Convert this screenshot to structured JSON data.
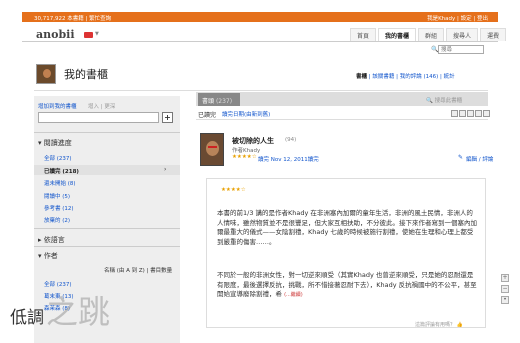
{
  "topbar": {
    "stats": "30,717,922 本書籍 | 繁忙查詢",
    "links": "我是Khady | 設定 | 登出"
  },
  "header": {
    "logo": "anobii",
    "search_placeholder": "搜尋"
  },
  "nav": {
    "tabs": [
      "首頁",
      "我的書櫃",
      "群組",
      "搜尋人",
      "運費"
    ]
  },
  "shelf": {
    "title": "我的書櫃",
    "links": {
      "current": "書櫃",
      "friends": "該關書籍",
      "reviews": "我的評論 (146)",
      "stats": "統計"
    }
  },
  "sidebar": {
    "add_label": "增加到我的書櫃",
    "add_hint": "增入 | 更深",
    "reading_status": "閱讀進度",
    "status_items": [
      {
        "label": "全部 (237)",
        "selected": false
      },
      {
        "label": "已讀完 (218)",
        "selected": true
      },
      {
        "label": "還未開始 (8)",
        "selected": false
      },
      {
        "label": "閱讀中 (5)",
        "selected": false
      },
      {
        "label": "參考書 (12)",
        "selected": false
      },
      {
        "label": "放棄的 (2)",
        "selected": false
      }
    ],
    "language": "依語言",
    "authors": "作者",
    "authors_sort": "名稱 (由 A 到 Z) | 書目數量",
    "author_items": [
      "全部 (237)",
      "葛末東 (13)",
      "森茉森 (8)"
    ]
  },
  "main": {
    "tab_label": "書頭",
    "tab_count": "(237)",
    "search_placeholder": "搜尋此書櫃",
    "filter_read": "已讀完",
    "filter_sort": "讀完日期(由新到舊)"
  },
  "book": {
    "title": "被切除的人生",
    "count": "(94)",
    "author": "作者Khady",
    "rating_stars": "★★★★☆",
    "date": "讀完 Nov 12, 2011讀完",
    "edit_link": "編輯 / 評論"
  },
  "review": {
    "stars": "★★★★☆",
    "p1": "本書的前1/3 講的是作者Khady 在非洲塞內加爾的童年生活，非洲的風土民情，非洲人的人情味，雖然物質並不是很豐足，但大家互相扶助，不分彼此。接下來作者寫到一個塞內加爾最重大的儀式——女陰割禮，Khady 七歲的時候被施行割禮，使她在生理和心理上都受到嚴重的傷害……。",
    "p2": "不同於一般的非洲女性，對一切逆來順受（其實Khady 也曾逆來順受，只是她的忍耐還是有限度，最後選擇反抗，挑戰，所不惜接著忍耐下去），Khady 反抗禍國中的不公平，甚至開始宣導廢除割禮，希",
    "more": "(...繼續)",
    "helpful": "這篇評論有用嗎？"
  },
  "watermark": {
    "text_a": "低調",
    "text_b": "之跳"
  }
}
